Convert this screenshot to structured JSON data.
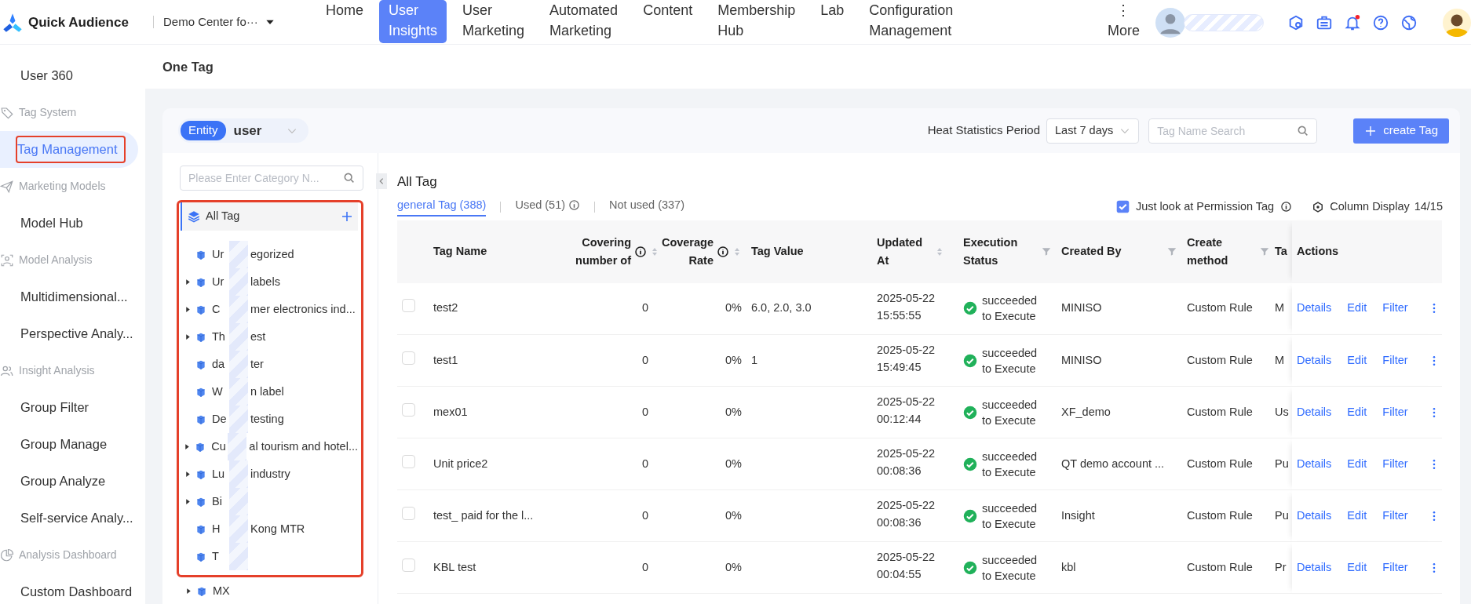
{
  "app": {
    "name": "Quick Audience",
    "workspace": "Demo Center fo···"
  },
  "nav": [
    {
      "label": "Home",
      "selected": false
    },
    {
      "label": "User Insights",
      "selected": true
    },
    {
      "label": "User Marketing",
      "selected": false
    },
    {
      "label": "Automated Marketing",
      "selected": false
    },
    {
      "label": "Content",
      "selected": false
    },
    {
      "label": "Membership Hub",
      "selected": false
    },
    {
      "label": "Lab",
      "selected": false
    },
    {
      "label": "Configuration Management",
      "selected": false
    },
    {
      "label": "More",
      "selected": false,
      "glyph": "⋮"
    }
  ],
  "notifications": {
    "unread": true
  },
  "sidebar": {
    "items": [
      {
        "kind": "item",
        "label": "User 360",
        "selected": false,
        "highlighted": false
      },
      {
        "kind": "group",
        "label": "Tag System"
      },
      {
        "kind": "item",
        "label": "Tag Management",
        "selected": true,
        "highlighted": true
      },
      {
        "kind": "group",
        "label": "Marketing Models"
      },
      {
        "kind": "item",
        "label": "Model Hub",
        "selected": false,
        "highlighted": false
      },
      {
        "kind": "group",
        "label": "Model Analysis"
      },
      {
        "kind": "item",
        "label": "Multidimensional...",
        "selected": false,
        "highlighted": false
      },
      {
        "kind": "item",
        "label": "Perspective Analy...",
        "selected": false,
        "highlighted": false
      },
      {
        "kind": "group",
        "label": "Insight Analysis"
      },
      {
        "kind": "item",
        "label": "Group Filter",
        "selected": false,
        "highlighted": false
      },
      {
        "kind": "item",
        "label": "Group Manage",
        "selected": false,
        "highlighted": false
      },
      {
        "kind": "item",
        "label": "Group Analyze",
        "selected": false,
        "highlighted": false
      },
      {
        "kind": "item",
        "label": "Self-service Analy...",
        "selected": false,
        "highlighted": false
      },
      {
        "kind": "group",
        "label": "Analysis Dashboard"
      },
      {
        "kind": "item",
        "label": "Custom Dashboard",
        "selected": false,
        "highlighted": false
      }
    ]
  },
  "page_title": "One Tag",
  "entity": {
    "badge": "Entity",
    "value": "user"
  },
  "heat_period": {
    "label": "Heat Statistics Period",
    "value": "Last 7 days"
  },
  "tag_search": {
    "placeholder": "Tag Name Search"
  },
  "create_button": {
    "label": "create Tag"
  },
  "category_search": {
    "placeholder": "Please Enter Category N..."
  },
  "tree": {
    "highlighted": true,
    "root": {
      "label": "All Tag",
      "selected": true
    },
    "items": [
      {
        "start": "Ur",
        "end": "egorized",
        "expandable": false,
        "masked": true
      },
      {
        "start": "Ur",
        "end": "labels",
        "expandable": true,
        "masked": true
      },
      {
        "start": "C",
        "end": "mer electronics ind...",
        "expandable": true,
        "masked": true
      },
      {
        "start": "Th",
        "end": "est",
        "expandable": true,
        "masked": true
      },
      {
        "start": "da",
        "end": "ter",
        "expandable": false,
        "masked": true
      },
      {
        "start": "W",
        "end": "n label",
        "expandable": false,
        "masked": true
      },
      {
        "start": "De",
        "end": "testing",
        "expandable": false,
        "masked": true
      },
      {
        "start": "Cu",
        "end": "al tourism and hotel...",
        "expandable": true,
        "masked": true
      },
      {
        "start": "Lu",
        "end": "industry",
        "expandable": true,
        "masked": true
      },
      {
        "start": "Bi",
        "expandable": true,
        "masked": true
      },
      {
        "start": "H",
        "end": "Kong MTR",
        "expandable": false,
        "masked": true
      },
      {
        "start": "T",
        "expandable": false,
        "masked": true
      },
      {
        "start": "MX",
        "expandable": true,
        "masked": false
      }
    ]
  },
  "list_title": "All Tag",
  "tabs": [
    {
      "label": "general Tag (388)",
      "selected": true
    },
    {
      "label": "Used (51)",
      "selected": false,
      "info": true
    },
    {
      "label": "Not used (337)",
      "selected": false
    }
  ],
  "permission_filter": {
    "label": "Just look at Permission Tag",
    "checked": true,
    "info": true
  },
  "column_display": {
    "label": "Column Display",
    "count": "14/15"
  },
  "table": {
    "columns": [
      {
        "label": "Tag Name",
        "kind": "text"
      },
      {
        "label": "Covering number of",
        "kind": "number",
        "info": true,
        "sortable": true
      },
      {
        "label": "Coverage Rate",
        "kind": "number",
        "info": true,
        "sortable": true
      },
      {
        "label": "Tag Value",
        "kind": "text"
      },
      {
        "label": "Updated At",
        "kind": "date",
        "sortable": true
      },
      {
        "label": "Execution Status",
        "kind": "status",
        "filterable": true
      },
      {
        "label": "Created By",
        "kind": "text",
        "filterable": true
      },
      {
        "label": "Create method",
        "kind": "text",
        "filterable": true
      },
      {
        "label": "Ta",
        "kind": "cut"
      },
      {
        "label": "Actions",
        "kind": "actions"
      }
    ],
    "rows": [
      {
        "selected": false,
        "cells": [
          "test2",
          "0",
          "0%",
          "6.0, 2.0, 3.0",
          [
            "2025-05-22",
            "15:55:55"
          ],
          {
            "text": "succeeded to Execute",
            "succeeded": true
          },
          "MINISO",
          "Custom Rule",
          "M",
          [
            "Details",
            "Edit",
            "Filter"
          ]
        ]
      },
      {
        "selected": false,
        "cells": [
          "test1",
          "0",
          "0%",
          "1",
          [
            "2025-05-22",
            "15:49:45"
          ],
          {
            "text": "succeeded to Execute",
            "succeeded": true
          },
          "MINISO",
          "Custom Rule",
          "M",
          [
            "Details",
            "Edit",
            "Filter"
          ]
        ]
      },
      {
        "selected": false,
        "cells": [
          "mex01",
          "0",
          "0%",
          null,
          [
            "2025-05-22",
            "00:12:44"
          ],
          {
            "text": "succeeded to Execute",
            "succeeded": true
          },
          "XF_demo",
          "Custom Rule",
          "Us",
          [
            "Details",
            "Edit",
            "Filter"
          ]
        ]
      },
      {
        "selected": false,
        "cells": [
          "Unit price2",
          "0",
          "0%",
          null,
          [
            "2025-05-22",
            "00:08:36"
          ],
          {
            "text": "succeeded to Execute",
            "succeeded": true
          },
          "QT demo account ...",
          "Custom Rule",
          "Pu",
          [
            "Details",
            "Edit",
            "Filter"
          ]
        ]
      },
      {
        "selected": false,
        "cells": [
          "test_ paid for the l...",
          "0",
          "0%",
          null,
          [
            "2025-05-22",
            "00:08:36"
          ],
          {
            "text": "succeeded to Execute",
            "succeeded": true
          },
          "Insight",
          "Custom Rule",
          "Pu",
          [
            "Details",
            "Edit",
            "Filter"
          ]
        ]
      },
      {
        "selected": false,
        "cells": [
          "KBL test",
          "0",
          "0%",
          null,
          [
            "2025-05-22",
            "00:04:55"
          ],
          {
            "text": "succeeded to Execute",
            "succeeded": true
          },
          "kbl",
          "Custom Rule",
          "Pr",
          [
            "Details",
            "Edit",
            "Filter"
          ]
        ]
      }
    ]
  }
}
